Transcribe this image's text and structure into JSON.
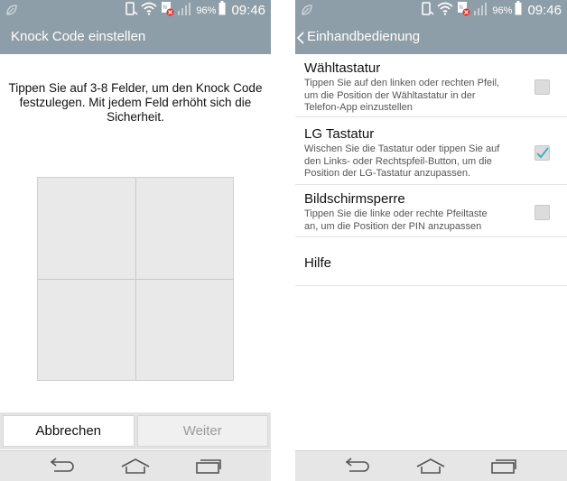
{
  "status": {
    "battery": "96%",
    "time": "09:46"
  },
  "left": {
    "title": "Knock Code einstellen",
    "instruction_line1": "Tippen Sie auf 3-8 Felder, um den Knock Code",
    "instruction_line2": "festzulegen. Mit jedem Feld erhöht sich die",
    "instruction_line3": "Sicherheit.",
    "cancel_label": "Abbrechen",
    "next_label": "Weiter"
  },
  "right": {
    "title": "Einhandbedienung",
    "items": [
      {
        "title": "Wähltastatur",
        "desc_lines": [
          "Tippen Sie auf den linken oder rechten Pfeil,",
          "um die Position der Wähltastatur in der",
          "Telefon-App einzustellen"
        ],
        "checked": false
      },
      {
        "title": "LG Tastatur",
        "desc_lines": [
          "Wischen Sie die Tastatur oder tippen Sie auf",
          "den Links- oder Rechtspfeil-Button, um die",
          "Position der LG-Tastatur anzupassen."
        ],
        "checked": true
      },
      {
        "title": "Bildschirmsperre",
        "desc_lines": [
          "Tippen Sie die linke oder rechte Pfeiltaste",
          "an, um die Position der PIN anzupassen"
        ],
        "checked": false
      },
      {
        "title": "Hilfe",
        "desc_lines": [],
        "checked": false
      }
    ]
  },
  "icons": {
    "leaf": "leaf-icon",
    "rotation": "screen-rotation-icon",
    "wifi": "wifi-icon",
    "nfc": "nfc-error-icon",
    "signal": "signal-icon",
    "back": "back-icon",
    "home": "home-icon",
    "recents": "recent-apps-icon",
    "chevron": "chevron-left-icon",
    "check": "checkmark-icon"
  },
  "colors": {
    "bar": "#8e9ea8",
    "check_accent": "#3bb4c8"
  }
}
